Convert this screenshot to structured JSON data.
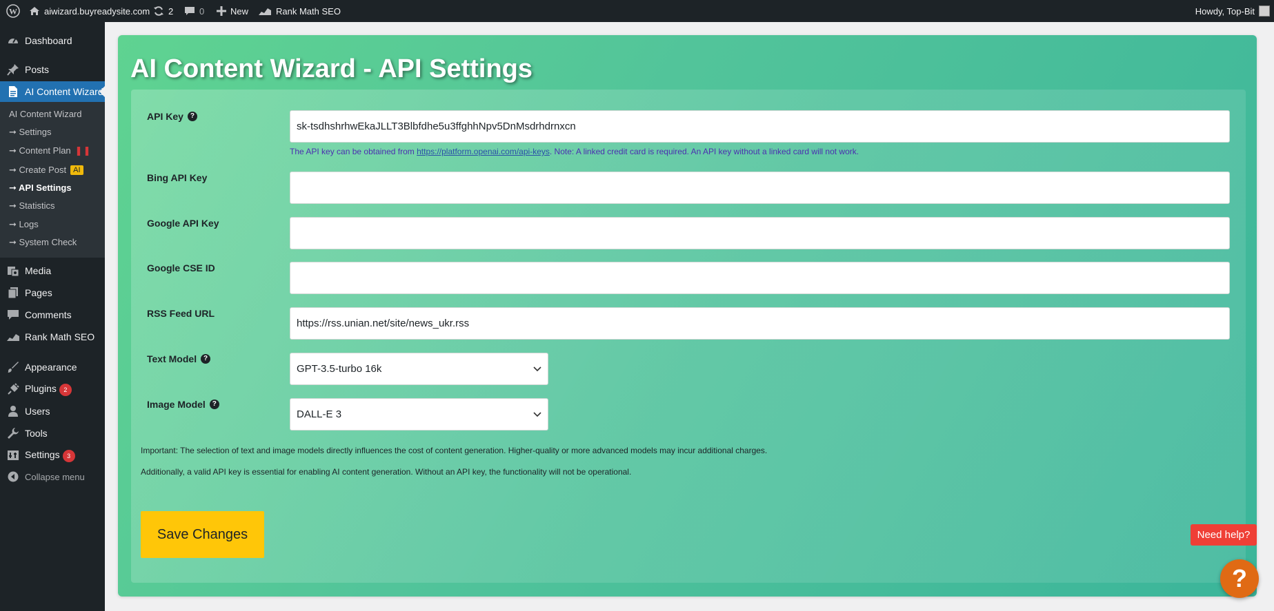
{
  "admin_bar": {
    "site_name": "aiwizard.buyreadysite.com",
    "updates_count": "2",
    "comments_count": "0",
    "new_label": "New",
    "rank_math_label": "Rank Math SEO",
    "howdy": "Howdy, Top-Bit"
  },
  "sidebar": {
    "items": [
      {
        "label": "Dashboard",
        "icon": "dashboard-icon"
      },
      {
        "label": "Posts",
        "icon": "pin-icon"
      },
      {
        "label": "AI Content Wizard",
        "icon": "document-icon"
      },
      {
        "label": "Media",
        "icon": "media-icon"
      },
      {
        "label": "Pages",
        "icon": "pages-icon"
      },
      {
        "label": "Comments",
        "icon": "comment-icon"
      },
      {
        "label": "Rank Math SEO",
        "icon": "rank-math-icon"
      },
      {
        "label": "Appearance",
        "icon": "brush-icon"
      },
      {
        "label": "Plugins",
        "icon": "plugin-icon",
        "badge": "2"
      },
      {
        "label": "Users",
        "icon": "user-icon"
      },
      {
        "label": "Tools",
        "icon": "wrench-icon"
      },
      {
        "label": "Settings",
        "icon": "settings-icon",
        "badge": "3"
      },
      {
        "label": "Collapse menu",
        "icon": "collapse-icon"
      }
    ],
    "submenu": {
      "heading": "AI Content Wizard",
      "items": [
        {
          "label": "➞ Settings"
        },
        {
          "label": "➞ Content Plan",
          "badge": "❚❚"
        },
        {
          "label": "➞ Create Post",
          "badge": "AI"
        },
        {
          "label": "➞ API Settings",
          "active": true
        },
        {
          "label": "➞ Statistics"
        },
        {
          "label": "➞ Logs"
        },
        {
          "label": "➞ System Check"
        }
      ]
    }
  },
  "main": {
    "title": "AI Content Wizard - API Settings",
    "fields": {
      "api_key": {
        "label": "API Key",
        "value": "sk-tsdhshrhwEkaJLLT3Blbfdhe5u3ffghhNpv5DnMsdrhdrnxcn"
      },
      "api_key_hint": {
        "prefix": "The API key can be obtained from ",
        "link": "https://platform.openai.com/api-keys",
        "suffix": ". Note: A linked credit card is required. An API key without a linked card will not work."
      },
      "bing_api_key": {
        "label": "Bing API Key",
        "value": ""
      },
      "google_api_key": {
        "label": "Google API Key",
        "value": ""
      },
      "google_cse_id": {
        "label": "Google CSE ID",
        "value": ""
      },
      "rss_feed_url": {
        "label": "RSS Feed URL",
        "value": "https://rss.unian.net/site/news_ukr.rss"
      },
      "text_model": {
        "label": "Text Model",
        "value": "GPT-3.5-turbo 16k"
      },
      "image_model": {
        "label": "Image Model",
        "value": "DALL-E 3"
      }
    },
    "notice_1": "Important: The selection of text and image models directly influences the cost of content generation. Higher-quality or more advanced models may incur additional charges.",
    "notice_2": "Additionally, a valid API key is essential for enabling AI content generation. Without an API key, the functionality will not be operational.",
    "save_label": "Save Changes",
    "need_help_label": "Need help?",
    "help_bubble_glyph": "?"
  },
  "colors": {
    "admin_dark": "#1d2327",
    "admin_blue": "#2271b1",
    "card_gradient_start": "#5fd391",
    "card_gradient_end": "#3bb59a",
    "save_button": "#ffc608",
    "need_help": "#ef3f36",
    "help_bubble": "#e06a14"
  }
}
